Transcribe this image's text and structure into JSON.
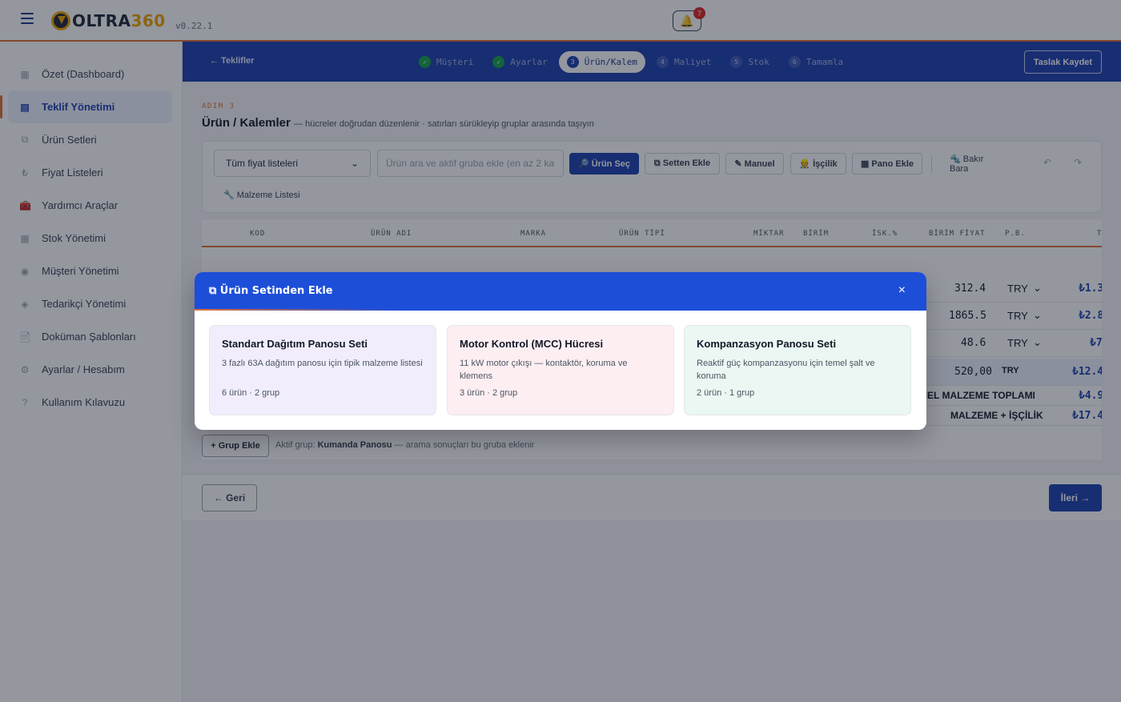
{
  "app": {
    "logo_text_main": "OLTRA",
    "logo_text_accent": "360",
    "version": "v0.22.1",
    "notification_count": "7",
    "notification_icon": "bell-icon"
  },
  "sidebar": {
    "items": [
      {
        "label": "Özet (Dashboard)",
        "icon": "▦"
      },
      {
        "label": "Teklif Yönetimi",
        "icon": "▤"
      },
      {
        "label": "Ürün Setleri",
        "icon": "⧉"
      },
      {
        "label": "Fiyat Listeleri",
        "icon": "₺"
      },
      {
        "label": "Yardımcı Araçlar",
        "icon": "🧰"
      },
      {
        "label": "Stok Yönetimi",
        "icon": "▦"
      },
      {
        "label": "Müşteri Yönetimi",
        "icon": "◉"
      },
      {
        "label": "Tedarikçi Yönetimi",
        "icon": "◈"
      },
      {
        "label": "Doküman Şablonları",
        "icon": "📄"
      },
      {
        "label": "Ayarlar / Hesabım",
        "icon": "⚙"
      },
      {
        "label": "Kullanım Kılavuzu",
        "icon": "?"
      }
    ]
  },
  "stepbar": {
    "back": "← Teklifler",
    "steps": [
      {
        "num": "✓",
        "label": "Müşteri"
      },
      {
        "num": "✓",
        "label": "Ayarlar"
      },
      {
        "num": "3",
        "label": "Ürün/Kalem"
      },
      {
        "num": "4",
        "label": "Maliyet"
      },
      {
        "num": "5",
        "label": "Stok"
      },
      {
        "num": "6",
        "label": "Tamamla"
      }
    ],
    "save_draft": "Taslak Kaydet"
  },
  "page": {
    "eyebrow": "ADIM 3",
    "title": "Ürün / Kalemler",
    "subtitle": "— hücreler doğrudan düzenlenir · satırları sürükleyip gruplar arasında taşıyın"
  },
  "toolbar": {
    "price_list_select": "Tüm fiyat listeleri",
    "search_placeholder": "Ürün ara ve aktif gruba ekle (en az 2 ka",
    "btn_select_product": "🔎 Ürün Seç",
    "btn_from_set": "⧉ Setten Ekle",
    "btn_manual": "✎ Manuel",
    "btn_labor": "👷 İşçilik",
    "btn_panel": "▦ Pano Ekle",
    "btn_copper": "🔩 Bakır Bara",
    "undo": "↶",
    "redo": "↷",
    "bom": "🔧 Malzeme Listesi"
  },
  "table": {
    "headers": [
      "KOD",
      "ÜRÜN ADI",
      "MARKA",
      "ÜRÜN TİPİ",
      "MİKTAR",
      "BİRİM",
      "İSK.%",
      "BİRİM FİYAT",
      "P.B.",
      "T"
    ],
    "rows": [
      {
        "price": "312.4",
        "currency": "TRY",
        "total": "₺1.3"
      },
      {
        "price": "1865.5",
        "currency": "TRY",
        "total": "₺2.8"
      },
      {
        "price": "48.6",
        "currency": "TRY",
        "total": "₺7"
      }
    ],
    "group_row": {
      "price": "520,00",
      "currency": "TRY",
      "total": "₺12.4"
    },
    "total_rows": [
      {
        "label": "GENEL MALZEME TOPLAMI",
        "value": "₺4.9"
      },
      {
        "label": "MALZEME + İŞÇİLİK",
        "value": "₺17.4"
      }
    ]
  },
  "groups": {
    "add_group": "+ Grup Ekle",
    "active_prefix": "Aktif grup:",
    "active_name": "Kumanda Panosu",
    "active_suffix": "— arama sonuçları bu gruba eklenir"
  },
  "footer": {
    "back": "← Geri",
    "next": "İleri →"
  },
  "modal": {
    "title": "⧉ Ürün Setinden Ekle",
    "close": "×",
    "sets": [
      {
        "name": "Standart Dağıtım Panosu Seti",
        "description": "3 fazlı 63A dağıtım panosu için tipik malzeme listesi",
        "meta": "6 ürün · 2 grup",
        "color": "#f1edfc"
      },
      {
        "name": "Motor Kontrol (MCC) Hücresi",
        "description": "11 kW motor çıkışı — kontaktör, koruma ve klemens",
        "meta": "3 ürün · 2 grup",
        "color": "#fdeef1"
      },
      {
        "name": "Kompanzasyon Panosu Seti",
        "description": "Reaktif güç kompanzasyonu için temel şalt ve koruma",
        "meta": "2 ürün · 1 grup",
        "color": "#eaf7f2"
      }
    ]
  },
  "colors": {
    "brand_blue": "#1e40af",
    "accent_orange": "#e0703a",
    "logo_gold": "#f0a500"
  }
}
